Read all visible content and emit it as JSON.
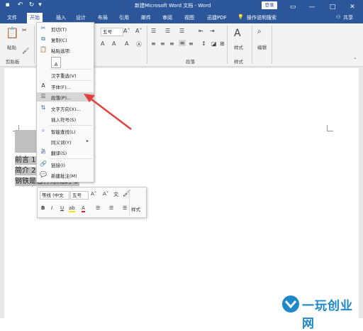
{
  "window": {
    "title": "新建Microsoft Word 文档 - Word",
    "login_label": "登录",
    "minimize_icon": "minimize-icon",
    "restore_icon": "restore-icon",
    "close_icon": "close-icon"
  },
  "ribbon_tabs": [
    "文件",
    "开始",
    "插入",
    "设计",
    "布局",
    "引用",
    "邮件",
    "审阅",
    "视图",
    "迅捷PDF"
  ],
  "tell_me": "操作说明搜索",
  "share_label": "共享",
  "ribbon": {
    "paste_label": "粘贴",
    "clipboard_group": "剪贴板",
    "font_size": "五号",
    "paragraph_group": "段落",
    "styles_label": "样式",
    "styles_group": "样式",
    "edit_label": "编辑"
  },
  "context_menu": {
    "items": [
      {
        "label": "剪切(T)",
        "icon": "scissors-icon"
      },
      {
        "label": "复制(C)",
        "icon": "copy-icon"
      },
      {
        "label": "粘贴选项:",
        "icon": "paste-icon"
      },
      {
        "label": "汉字重选(V)",
        "icon": ""
      },
      {
        "label": "字体(F)...",
        "icon": "font-icon"
      },
      {
        "label": "段落(P)...",
        "icon": "paragraph-icon"
      },
      {
        "label": "文字方向(X)...",
        "icon": "text-direction-icon"
      },
      {
        "label": "插入符号(S)",
        "icon": ""
      },
      {
        "label": "智能查找(L)",
        "icon": "smart-lookup-icon"
      },
      {
        "label": "同义词(Y)",
        "icon": ""
      },
      {
        "label": "翻译(S)",
        "icon": "translate-icon"
      },
      {
        "label": "链接(I)",
        "icon": "link-icon"
      },
      {
        "label": "新建批注(M)",
        "icon": "comment-icon"
      }
    ]
  },
  "document": {
    "lines": [
      "前言 1",
      "简介 2",
      "钢铁是怎样炼成的 3"
    ]
  },
  "mini_toolbar": {
    "font_name": "等线 (中文",
    "font_size": "五号",
    "styles_label": "样式"
  },
  "watermark": {
    "text": "一玩创业网"
  }
}
